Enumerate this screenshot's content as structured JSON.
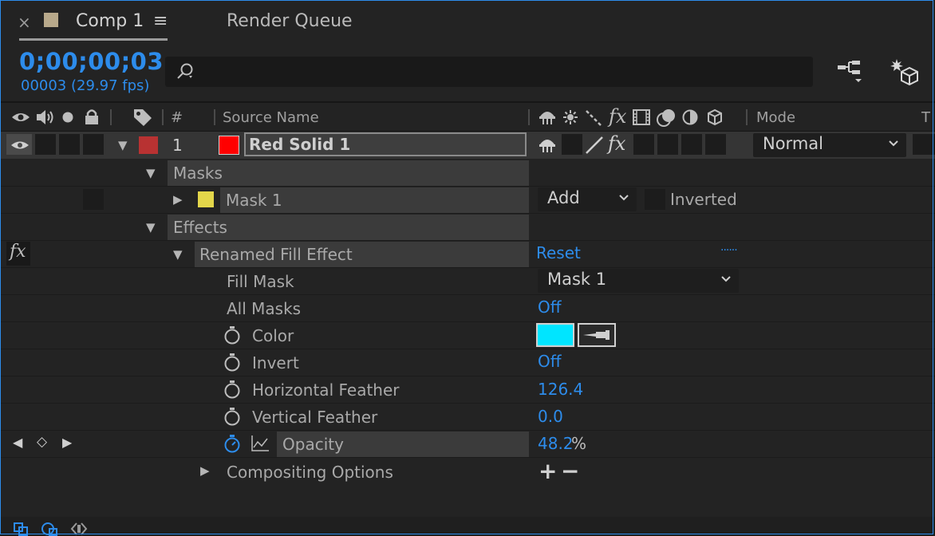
{
  "tabs": {
    "close_glyph": "×",
    "comp_title": "Comp 1",
    "comp_swatch_color": "#b8a98b",
    "menu_glyph": "≡",
    "render_queue": "Render Queue"
  },
  "time": {
    "timecode": "0;00;00;03",
    "frame_fps": "00003 (29.97 fps)"
  },
  "search": {
    "value": "",
    "placeholder": ""
  },
  "toolbar_icons": [
    "comp-flowchart-icon",
    "draft-3d-icon"
  ],
  "columns": {
    "number": "#",
    "source_name": "Source Name",
    "mode": "Mode",
    "trkmat": "T"
  },
  "layer": {
    "number": "1",
    "label_color": "#b83232",
    "solid_color": "#ff0000",
    "name": "Red Solid 1",
    "mode": "Normal"
  },
  "groups": {
    "masks": "Masks",
    "effects": "Effects",
    "compositing_options": "Compositing Options"
  },
  "mask": {
    "name": "Mask 1",
    "color": "#e3d64a",
    "mode": "Add",
    "inverted_label": "Inverted"
  },
  "effect": {
    "fx_glyph": "fx",
    "name": "Renamed Fill Effect",
    "reset": "Reset",
    "about": "......"
  },
  "properties": [
    {
      "name": "Fill Mask",
      "value": "Mask 1"
    },
    {
      "name": "All Masks",
      "value": "Off"
    },
    {
      "name": "Color",
      "value": "#00e5ff"
    },
    {
      "name": "Invert",
      "value": "Off"
    },
    {
      "name": "Horizontal Feather",
      "value": "126.4"
    },
    {
      "name": "Vertical Feather",
      "value": "0.0"
    },
    {
      "name": "Opacity",
      "value": "48.2",
      "unit": "%"
    }
  ],
  "compositing": {
    "add": "+",
    "remove": "−"
  }
}
